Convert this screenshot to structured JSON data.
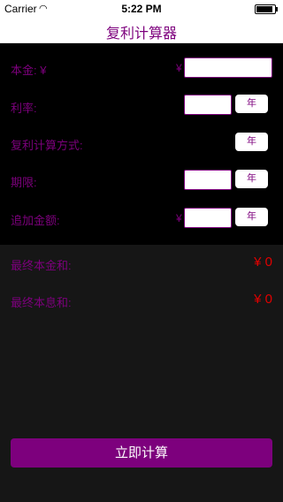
{
  "status": {
    "carrier": "Carrier",
    "wifi_icon": "wifi-icon",
    "time": "5:22 PM",
    "battery_level": 0.9
  },
  "nav": {
    "title": "复利计算器"
  },
  "form": {
    "principal_label": "本金: ¥",
    "principal_currency": "¥",
    "rate_label": "利率:",
    "compound_label": "复利计算方式:",
    "term_label": "期限:",
    "extra_label": "追加金额:",
    "extra_currency": "¥",
    "rate_unit": "年",
    "compound_unit": "年",
    "term_unit": "年",
    "extra_unit": "年"
  },
  "results": {
    "final_total_label": "最终本金和:",
    "final_total_value": "¥ 0",
    "final_interest_label": "最终本息和:",
    "final_interest_value": "¥ 0"
  },
  "actions": {
    "calculate_label": "立即计算"
  },
  "colors": {
    "accent": "#7d007d",
    "value": "#e00000",
    "bg": "#000000",
    "results_bg": "#161616"
  }
}
